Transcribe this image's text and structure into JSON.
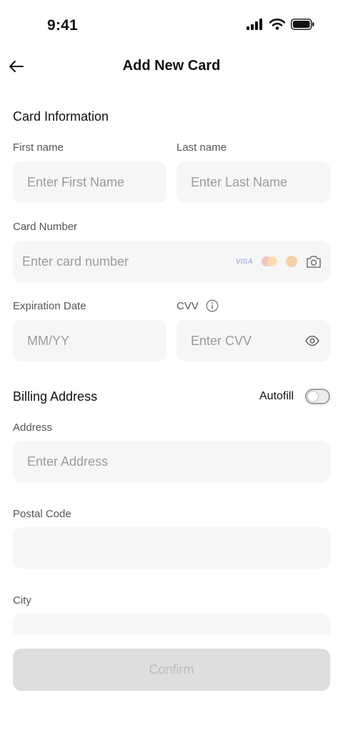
{
  "status_bar": {
    "time": "9:41",
    "icons": [
      "signal-icon",
      "wifi-icon",
      "battery-icon"
    ]
  },
  "nav": {
    "title": "Add New Card",
    "back_icon": "arrow-left-icon"
  },
  "card_info": {
    "title": "Card Information",
    "first_name": {
      "label": "First name",
      "placeholder": "Enter First Name",
      "value": ""
    },
    "last_name": {
      "label": "Last name",
      "placeholder": "Enter Last Name",
      "value": ""
    },
    "card_number": {
      "label": "Card Number",
      "placeholder": "Enter card number",
      "value": "",
      "brand_text": "VISA",
      "brand_icons": [
        "visa-icon",
        "mastercard-icon",
        "discover-icon"
      ],
      "scan_icon": "camera-icon"
    },
    "expiration": {
      "label": "Expiration Date",
      "placeholder": "MM/YY",
      "value": ""
    },
    "cvv": {
      "label": "CVV",
      "placeholder": "Enter CVV",
      "value": "",
      "info_icon": "info-icon",
      "reveal_icon": "eye-icon"
    }
  },
  "billing": {
    "title": "Billing Address",
    "autofill": {
      "label": "Autofill",
      "enabled": false
    },
    "address": {
      "label": "Address",
      "placeholder": "Enter Address",
      "value": ""
    },
    "postal_code": {
      "label": "Postal Code",
      "placeholder": "",
      "value": ""
    },
    "city": {
      "label": "City",
      "placeholder": "",
      "value": ""
    }
  },
  "confirm_label": "Confirm",
  "colors": {
    "field_bg": "#f6f6f6",
    "label": "#555555",
    "placeholder": "#9b9b9b",
    "button_disabled": "#dedede",
    "button_text_disabled": "#bdbdbd"
  }
}
